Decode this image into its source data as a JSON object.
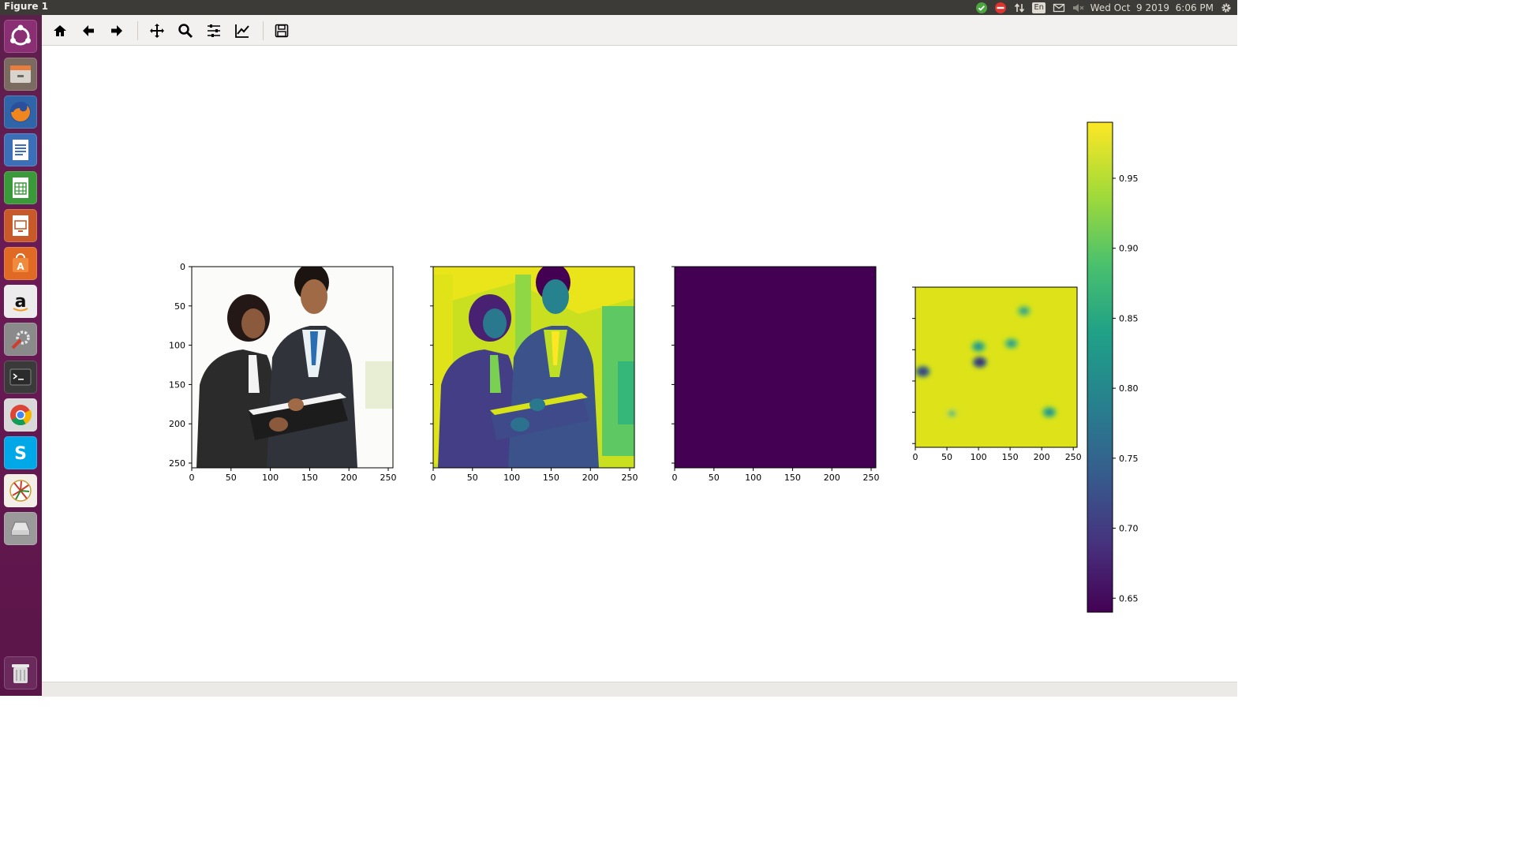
{
  "window": {
    "title": "Figure 1"
  },
  "tray": {
    "keyboard_layout": "En",
    "datetime": "Wed Oct  9 2019  6:06 PM",
    "icons": [
      "check-shield-icon",
      "no-entry-icon",
      "network-arrows-icon",
      "keyboard-layout-icon",
      "mail-icon",
      "volume-muted-icon",
      "settings-gear-icon"
    ]
  },
  "launcher": {
    "items": [
      "ubuntu-dash-icon",
      "files-icon",
      "firefox-icon",
      "writer-icon",
      "calc-icon",
      "impress-icon",
      "software-center-icon",
      "amazon-icon",
      "system-settings-icon",
      "terminal-icon",
      "chrome-icon",
      "skype-icon",
      "pinwheel-app-icon",
      "drive-icon",
      "trash-icon"
    ]
  },
  "toolbar": {
    "buttons": [
      "home-icon",
      "back-icon",
      "forward-icon",
      "pan-icon",
      "zoom-icon",
      "configure-subplots-icon",
      "edit-axes-icon",
      "save-icon"
    ]
  },
  "chart_data": [
    {
      "type": "image",
      "content": "photo of two business people reading a binder (RGB)",
      "xticks": [
        0,
        50,
        100,
        150,
        200,
        250
      ],
      "yticks": [
        0,
        50,
        100,
        150,
        200,
        250
      ],
      "xlim": [
        0,
        256
      ],
      "ylim": [
        256,
        0
      ]
    },
    {
      "type": "heatmap",
      "content": "same photo rendered as single-channel viridis image",
      "xticks": [
        0,
        50,
        100,
        150,
        200,
        250
      ],
      "xlim": [
        0,
        256
      ],
      "ylim": [
        256,
        0
      ],
      "colormap": "viridis"
    },
    {
      "type": "heatmap",
      "content": "uniform array (all dark purple)",
      "xticks": [
        0,
        50,
        100,
        150,
        200,
        250
      ],
      "xlim": [
        0,
        256
      ],
      "ylim": [
        256,
        0
      ],
      "colormap": "viridis",
      "fill_color": "#440154"
    },
    {
      "type": "heatmap",
      "content": "probability map, mostly ~0.97 with a few low spots",
      "xticks": [
        0,
        50,
        100,
        150,
        200,
        250
      ],
      "xlim": [
        0,
        256
      ],
      "ylim": [
        256,
        0
      ],
      "colormap": "viridis",
      "low_spots": [
        {
          "x": 12,
          "y": 135,
          "v": 0.68
        },
        {
          "x": 102,
          "y": 120,
          "v": 0.66
        },
        {
          "x": 100,
          "y": 95,
          "v": 0.8
        },
        {
          "x": 152,
          "y": 90,
          "v": 0.82
        },
        {
          "x": 172,
          "y": 38,
          "v": 0.83
        },
        {
          "x": 212,
          "y": 200,
          "v": 0.8
        },
        {
          "x": 58,
          "y": 202,
          "v": 0.88
        }
      ]
    },
    {
      "type": "colorbar",
      "ticks": [
        "0.65",
        "0.70",
        "0.75",
        "0.80",
        "0.85",
        "0.90",
        "0.95"
      ],
      "range": [
        0.64,
        0.99
      ],
      "colormap": "viridis"
    }
  ]
}
